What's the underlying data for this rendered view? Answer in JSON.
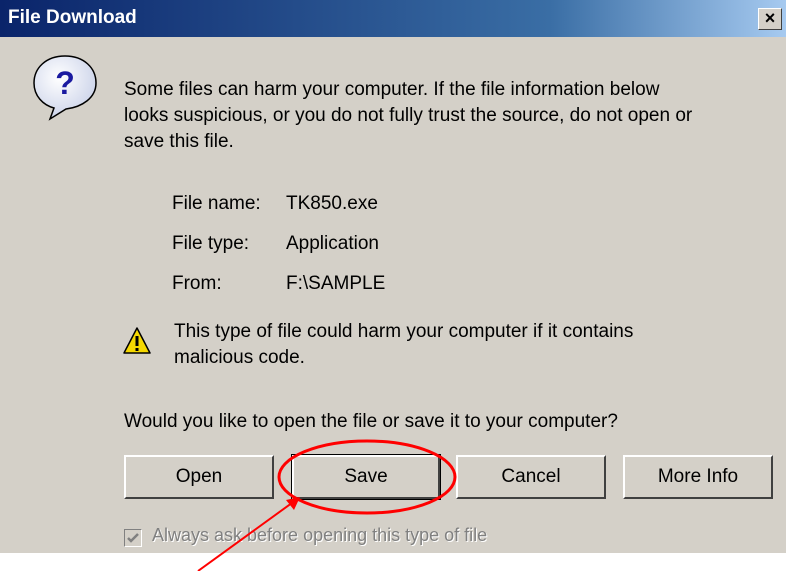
{
  "window": {
    "title": "File Download",
    "close_symbol": "×"
  },
  "message": {
    "line1": "Some files can harm your computer. If the file information below",
    "line2": "looks suspicious, or you do not fully trust the source, do not open or",
    "line3": "save this file."
  },
  "file_info": {
    "name_label": "File name:",
    "name_value": "TK850.exe",
    "type_label": "File type:",
    "type_value": "Application",
    "from_label": "From:",
    "from_value": "F:\\SAMPLE"
  },
  "warning": {
    "line1": "This type of file could harm your computer if it contains",
    "line2": "malicious code."
  },
  "question": "Would you like to open the file or save it to your computer?",
  "buttons": {
    "open": "Open",
    "save": "Save",
    "cancel": "Cancel",
    "more_info": "More Info"
  },
  "checkbox": {
    "label": "Always ask before opening this type of file",
    "checked": true,
    "enabled": false
  },
  "icons": {
    "info": "question-mark-balloon-icon",
    "warning": "warning-triangle-icon",
    "check": "checkmark-icon"
  },
  "annotation_color": "#ff0000"
}
